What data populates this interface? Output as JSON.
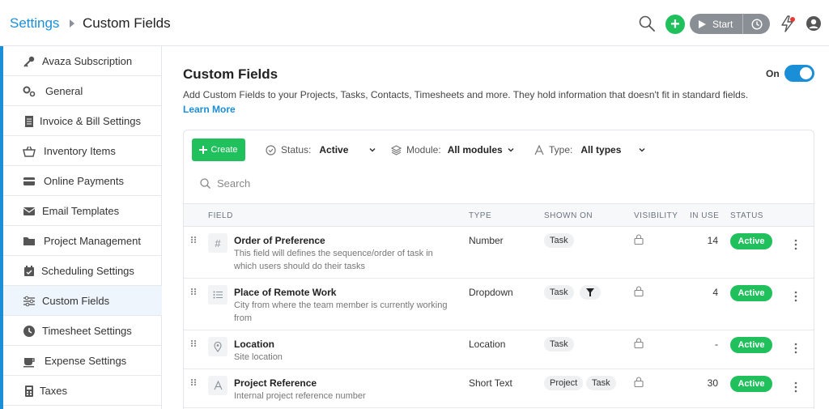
{
  "header": {
    "breadcrumb_root": "Settings",
    "page_title": "Custom Fields",
    "timer_start_label": "Start"
  },
  "sidebar": {
    "items": [
      {
        "label": "Avaza Subscription",
        "icon": "key-icon"
      },
      {
        "label": "General",
        "icon": "gears-icon"
      },
      {
        "label": "Invoice & Bill Settings",
        "icon": "document-icon"
      },
      {
        "label": "Inventory Items",
        "icon": "basket-icon"
      },
      {
        "label": "Online Payments",
        "icon": "credit-card-icon"
      },
      {
        "label": "Email Templates",
        "icon": "envelope-icon"
      },
      {
        "label": "Project Management",
        "icon": "folder-icon"
      },
      {
        "label": "Scheduling Settings",
        "icon": "calendar-icon"
      },
      {
        "label": "Custom Fields",
        "icon": "sliders-icon",
        "active": true
      },
      {
        "label": "Timesheet Settings",
        "icon": "clock-icon"
      },
      {
        "label": "Expense Settings",
        "icon": "coffee-cup-icon"
      },
      {
        "label": "Taxes",
        "icon": "calculator-icon"
      }
    ]
  },
  "main": {
    "title": "Custom Fields",
    "toggle_label": "On",
    "toggle_on": true,
    "description": "Add Custom Fields to your Projects, Tasks, Contacts, Timesheets and more. They hold information that doesn't fit in standard fields.",
    "learn_more": "Learn More"
  },
  "toolbar": {
    "create_label": "Create",
    "status_label": "Status:",
    "status_value": "Active",
    "module_label": "Module:",
    "module_value": "All modules",
    "type_label": "Type:",
    "type_value": "All types",
    "search_placeholder": "Search"
  },
  "table": {
    "columns": [
      "FIELD",
      "TYPE",
      "SHOWN ON",
      "VISIBILITY",
      "IN USE",
      "STATUS"
    ],
    "rows": [
      {
        "icon": "hash-icon",
        "name": "Order of Preference",
        "description": "This field will defines the sequence/order of task in which users should do their tasks",
        "type": "Number",
        "shown_on": [
          "Task"
        ],
        "in_use": "14",
        "status": "Active"
      },
      {
        "icon": "list-icon",
        "name": "Place of Remote Work",
        "description": "City from where the team member is currently working from",
        "type": "Dropdown",
        "shown_on": [
          "Task"
        ],
        "in_use": "4",
        "status": "Active"
      },
      {
        "icon": "location-pin-icon",
        "name": "Location",
        "description": "Site location",
        "type": "Location",
        "shown_on": [
          "Task"
        ],
        "in_use": "-",
        "status": "Active"
      },
      {
        "icon": "text-a-icon",
        "name": "Project Reference",
        "description": "Internal project reference number",
        "type": "Short Text",
        "shown_on": [
          "Project",
          "Task"
        ],
        "in_use": "30",
        "status": "Active"
      }
    ]
  },
  "colors": {
    "accent": "#1a8fd8",
    "success": "#20c05c",
    "muted_button": "#8a8f96"
  }
}
